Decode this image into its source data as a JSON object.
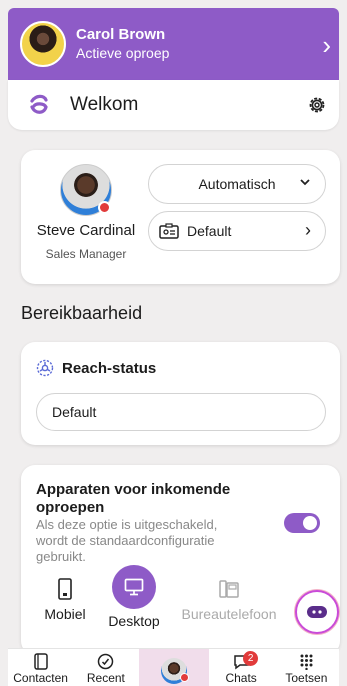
{
  "call_banner": {
    "name": "Carol Brown",
    "status": "Actieve oproep"
  },
  "header": {
    "title": "Welkom"
  },
  "profile": {
    "name": "Steve Cardinal",
    "role": "Sales Manager",
    "mode": "Automatisch",
    "device_profile": "Default"
  },
  "section": {
    "title": "Bereikbaarheid"
  },
  "reach": {
    "title": "Reach-status",
    "value": "Default"
  },
  "devices": {
    "title": "Apparaten voor inkomende oproepen",
    "description": "Als deze optie is uitgeschakeld, wordt de standaardconfiguratie gebruikt.",
    "toggle_on": true,
    "options": [
      "Mobiel",
      "Desktop",
      "Bureautelefoon"
    ],
    "selected": "Desktop"
  },
  "nav": {
    "items": [
      "Contacten",
      "Recent",
      "Chats",
      "Toetsen"
    ],
    "chats_badge": "2"
  },
  "colors": {
    "accent": "#8e5bc7",
    "presence_busy": "#e13b3b"
  }
}
